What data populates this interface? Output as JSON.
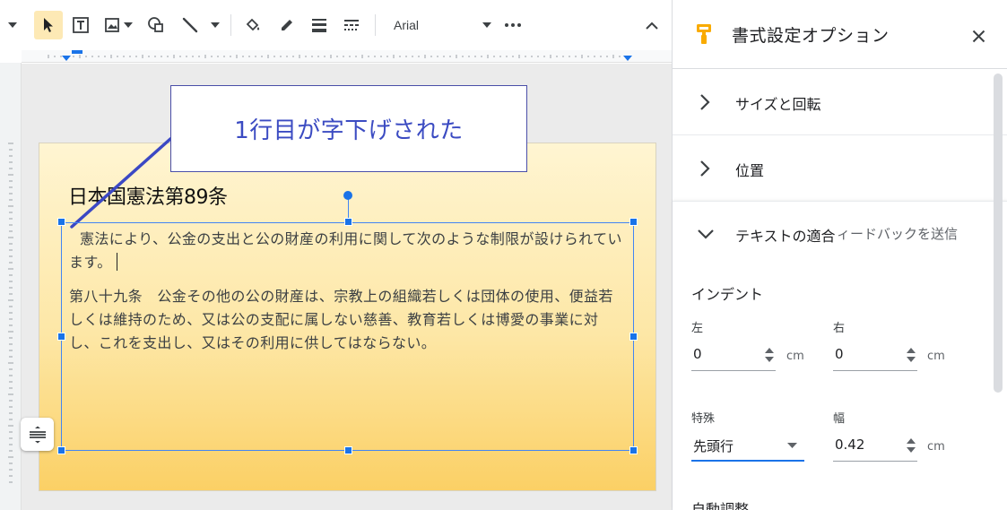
{
  "toolbar": {
    "font_name": "Arial"
  },
  "canvas": {
    "callout_text": "1行目が字下げされた",
    "slide_title": "日本国憲法第89条",
    "paragraph_1": "憲法により、公金の支出と公の財産の利用に関して次のような制限が設けられています。",
    "paragraph_2": "第八十九条　公金その他の公の財産は、宗教上の組織若しくは団体の使用、便益若しくは維持のため、又は公の支配に属しない慈善、教育若しくは博愛の事業に対し、これを支出し、又はその利用に供してはならない。"
  },
  "panel": {
    "title": "書式設定オプション",
    "sections": [
      {
        "label": "サイズと回転",
        "expanded": false
      },
      {
        "label": "位置",
        "expanded": false
      },
      {
        "label": "テキストの適合",
        "expanded": true
      }
    ],
    "feedback_text": "ィードバックを送信",
    "indent": {
      "heading": "インデント",
      "left_label": "左",
      "left_value": "0",
      "right_label": "右",
      "right_value": "0",
      "unit": "cm",
      "special_label": "特殊",
      "special_value": "先頭行",
      "width_label": "幅",
      "width_value": "0.42"
    },
    "autofit_heading_partial": "自動調整"
  },
  "colors": {
    "accent": "#1a73e8",
    "selected_tool_bg": "#fde9b5",
    "callout_text": "#3b4bc2",
    "slide_top": "#fff5d2",
    "slide_bottom": "#fbd065",
    "brand_icon": "#f9ab00"
  },
  "icons": {
    "panel_icon": "paint-roller-icon",
    "close": "close-icon",
    "expand": "chevron-right-icon",
    "collapse": "chevron-down-icon"
  }
}
